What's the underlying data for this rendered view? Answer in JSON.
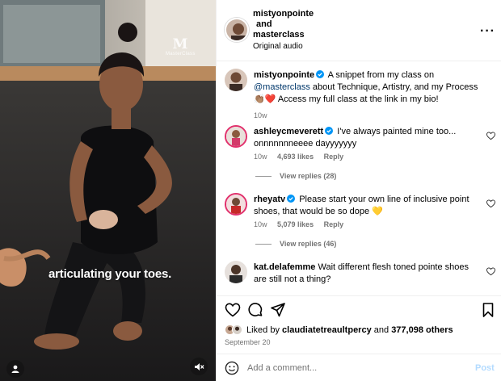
{
  "media": {
    "caption": "articulating your toes.",
    "watermark_mark": "M",
    "watermark_text": "MasterClass",
    "icons": {
      "user_tag": "user-tag-icon",
      "mute": "speaker-muted-icon"
    }
  },
  "header": {
    "user1": "mistyonpointe",
    "and_text": "and",
    "user2": "masterclass",
    "audio": "Original audio",
    "more_icon": "more-options-icon"
  },
  "comments": [
    {
      "user": "mistyonpointe",
      "verified": true,
      "text_before_link": "A snippet from my class on ",
      "link": "@masterclass",
      "text_after_link": " about Technique, Artistry, and my Process👏🏽❤️ Access my full class at the link in my bio!",
      "time": "10w"
    },
    {
      "user": "ashleycmeverett",
      "verified": true,
      "text": "I've always painted mine too... onnnnnnneeee dayyyyyyy",
      "time": "10w",
      "likes": "4,693 likes",
      "reply": "Reply",
      "view_replies": "View replies (28)"
    },
    {
      "user": "rheyatv",
      "verified": true,
      "text": "Please start your own line of inclusive point shoes, that would be so dope 💛",
      "time": "10w",
      "likes": "5,079 likes",
      "reply": "Reply",
      "view_replies": "View replies (46)"
    },
    {
      "user": "kat.delafemme",
      "verified": false,
      "text": "Wait different flesh toned pointe shoes are still not a thing?"
    }
  ],
  "actions": {
    "icons": [
      "heart-icon",
      "comment-icon",
      "share-icon",
      "bookmark-icon"
    ],
    "liked_by_prefix": "Liked by",
    "liked_by_user": "claudiatetreaultpercy",
    "liked_by_and": "and",
    "liked_by_count": "377,098 others",
    "date": "September 20"
  },
  "add_comment": {
    "placeholder": "Add a comment...",
    "post_label": "Post"
  },
  "colors": {
    "link": "#00376b",
    "verified": "#0095f6",
    "secondary_text": "#737373",
    "post_disabled": "#b3dbff",
    "divider": "#efefef"
  }
}
